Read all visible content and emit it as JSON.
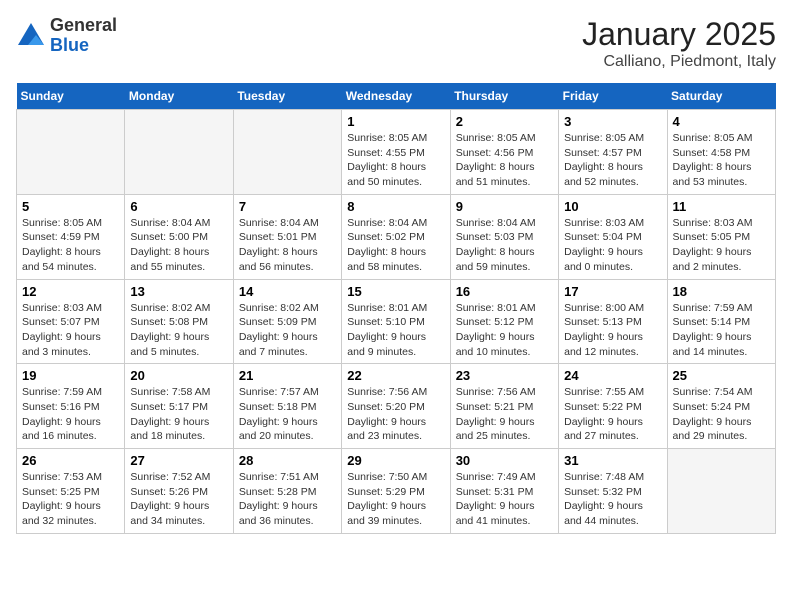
{
  "header": {
    "logo": {
      "general": "General",
      "blue": "Blue"
    },
    "title": "January 2025",
    "subtitle": "Calliano, Piedmont, Italy"
  },
  "weekdays": [
    "Sunday",
    "Monday",
    "Tuesday",
    "Wednesday",
    "Thursday",
    "Friday",
    "Saturday"
  ],
  "weeks": [
    [
      {
        "day": "",
        "info": ""
      },
      {
        "day": "",
        "info": ""
      },
      {
        "day": "",
        "info": ""
      },
      {
        "day": "1",
        "info": "Sunrise: 8:05 AM\nSunset: 4:55 PM\nDaylight: 8 hours\nand 50 minutes."
      },
      {
        "day": "2",
        "info": "Sunrise: 8:05 AM\nSunset: 4:56 PM\nDaylight: 8 hours\nand 51 minutes."
      },
      {
        "day": "3",
        "info": "Sunrise: 8:05 AM\nSunset: 4:57 PM\nDaylight: 8 hours\nand 52 minutes."
      },
      {
        "day": "4",
        "info": "Sunrise: 8:05 AM\nSunset: 4:58 PM\nDaylight: 8 hours\nand 53 minutes."
      }
    ],
    [
      {
        "day": "5",
        "info": "Sunrise: 8:05 AM\nSunset: 4:59 PM\nDaylight: 8 hours\nand 54 minutes."
      },
      {
        "day": "6",
        "info": "Sunrise: 8:04 AM\nSunset: 5:00 PM\nDaylight: 8 hours\nand 55 minutes."
      },
      {
        "day": "7",
        "info": "Sunrise: 8:04 AM\nSunset: 5:01 PM\nDaylight: 8 hours\nand 56 minutes."
      },
      {
        "day": "8",
        "info": "Sunrise: 8:04 AM\nSunset: 5:02 PM\nDaylight: 8 hours\nand 58 minutes."
      },
      {
        "day": "9",
        "info": "Sunrise: 8:04 AM\nSunset: 5:03 PM\nDaylight: 8 hours\nand 59 minutes."
      },
      {
        "day": "10",
        "info": "Sunrise: 8:03 AM\nSunset: 5:04 PM\nDaylight: 9 hours\nand 0 minutes."
      },
      {
        "day": "11",
        "info": "Sunrise: 8:03 AM\nSunset: 5:05 PM\nDaylight: 9 hours\nand 2 minutes."
      }
    ],
    [
      {
        "day": "12",
        "info": "Sunrise: 8:03 AM\nSunset: 5:07 PM\nDaylight: 9 hours\nand 3 minutes."
      },
      {
        "day": "13",
        "info": "Sunrise: 8:02 AM\nSunset: 5:08 PM\nDaylight: 9 hours\nand 5 minutes."
      },
      {
        "day": "14",
        "info": "Sunrise: 8:02 AM\nSunset: 5:09 PM\nDaylight: 9 hours\nand 7 minutes."
      },
      {
        "day": "15",
        "info": "Sunrise: 8:01 AM\nSunset: 5:10 PM\nDaylight: 9 hours\nand 9 minutes."
      },
      {
        "day": "16",
        "info": "Sunrise: 8:01 AM\nSunset: 5:12 PM\nDaylight: 9 hours\nand 10 minutes."
      },
      {
        "day": "17",
        "info": "Sunrise: 8:00 AM\nSunset: 5:13 PM\nDaylight: 9 hours\nand 12 minutes."
      },
      {
        "day": "18",
        "info": "Sunrise: 7:59 AM\nSunset: 5:14 PM\nDaylight: 9 hours\nand 14 minutes."
      }
    ],
    [
      {
        "day": "19",
        "info": "Sunrise: 7:59 AM\nSunset: 5:16 PM\nDaylight: 9 hours\nand 16 minutes."
      },
      {
        "day": "20",
        "info": "Sunrise: 7:58 AM\nSunset: 5:17 PM\nDaylight: 9 hours\nand 18 minutes."
      },
      {
        "day": "21",
        "info": "Sunrise: 7:57 AM\nSunset: 5:18 PM\nDaylight: 9 hours\nand 20 minutes."
      },
      {
        "day": "22",
        "info": "Sunrise: 7:56 AM\nSunset: 5:20 PM\nDaylight: 9 hours\nand 23 minutes."
      },
      {
        "day": "23",
        "info": "Sunrise: 7:56 AM\nSunset: 5:21 PM\nDaylight: 9 hours\nand 25 minutes."
      },
      {
        "day": "24",
        "info": "Sunrise: 7:55 AM\nSunset: 5:22 PM\nDaylight: 9 hours\nand 27 minutes."
      },
      {
        "day": "25",
        "info": "Sunrise: 7:54 AM\nSunset: 5:24 PM\nDaylight: 9 hours\nand 29 minutes."
      }
    ],
    [
      {
        "day": "26",
        "info": "Sunrise: 7:53 AM\nSunset: 5:25 PM\nDaylight: 9 hours\nand 32 minutes."
      },
      {
        "day": "27",
        "info": "Sunrise: 7:52 AM\nSunset: 5:26 PM\nDaylight: 9 hours\nand 34 minutes."
      },
      {
        "day": "28",
        "info": "Sunrise: 7:51 AM\nSunset: 5:28 PM\nDaylight: 9 hours\nand 36 minutes."
      },
      {
        "day": "29",
        "info": "Sunrise: 7:50 AM\nSunset: 5:29 PM\nDaylight: 9 hours\nand 39 minutes."
      },
      {
        "day": "30",
        "info": "Sunrise: 7:49 AM\nSunset: 5:31 PM\nDaylight: 9 hours\nand 41 minutes."
      },
      {
        "day": "31",
        "info": "Sunrise: 7:48 AM\nSunset: 5:32 PM\nDaylight: 9 hours\nand 44 minutes."
      },
      {
        "day": "",
        "info": ""
      }
    ]
  ]
}
